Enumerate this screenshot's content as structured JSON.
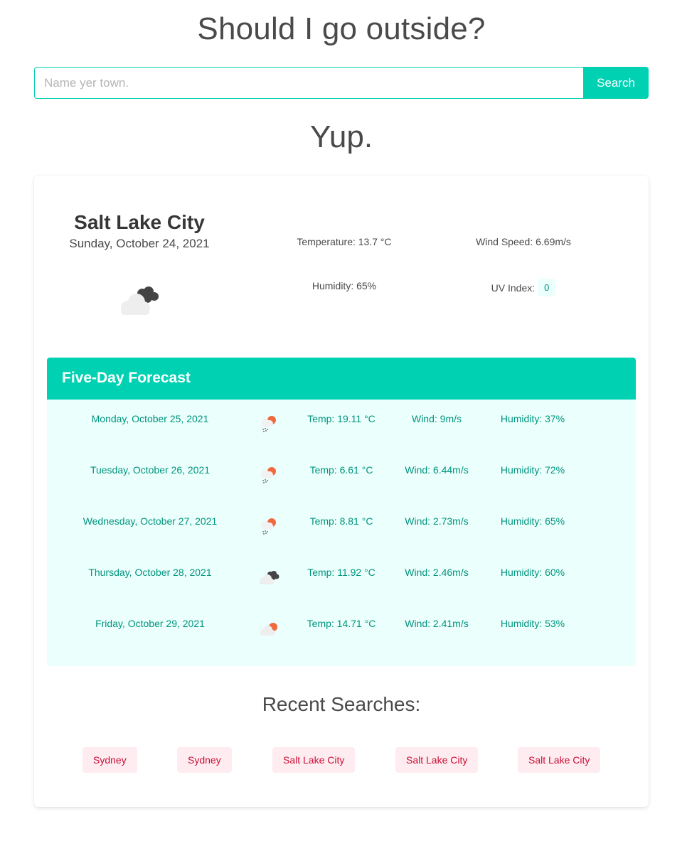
{
  "header": {
    "title": "Should I go outside?"
  },
  "search": {
    "placeholder": "Name yer town.",
    "value": "",
    "button_label": "Search"
  },
  "verdict": "Yup.",
  "current": {
    "city": "Salt Lake City",
    "date": "Sunday, October 24, 2021",
    "icon": "cloudy-icon",
    "temperature": "Temperature: 13.7 °C",
    "wind": "Wind Speed: 6.69m/s",
    "humidity": "Humidity: 65%",
    "uv_label": "UV Index:",
    "uv_value": "0"
  },
  "forecast": {
    "title": "Five-Day Forecast",
    "days": [
      {
        "date": "Monday, October 25, 2021",
        "icon": "sun-rain-icon",
        "temp": "Temp: 19.11 °C",
        "wind": "Wind: 9m/s",
        "humidity": "Humidity: 37%"
      },
      {
        "date": "Tuesday, October 26, 2021",
        "icon": "sun-rain-icon",
        "temp": "Temp: 6.61 °C",
        "wind": "Wind: 6.44m/s",
        "humidity": "Humidity: 72%"
      },
      {
        "date": "Wednesday, October 27, 2021",
        "icon": "sun-rain-icon",
        "temp": "Temp: 8.81 °C",
        "wind": "Wind: 2.73m/s",
        "humidity": "Humidity: 65%"
      },
      {
        "date": "Thursday, October 28, 2021",
        "icon": "cloudy-icon",
        "temp": "Temp: 11.92 °C",
        "wind": "Wind: 2.46m/s",
        "humidity": "Humidity: 60%"
      },
      {
        "date": "Friday, October 29, 2021",
        "icon": "partly-cloudy-icon",
        "temp": "Temp: 14.71 °C",
        "wind": "Wind: 2.41m/s",
        "humidity": "Humidity: 53%"
      }
    ]
  },
  "recent": {
    "title": "Recent Searches:",
    "items": [
      "Sydney",
      "Sydney",
      "Salt Lake City",
      "Salt Lake City",
      "Salt Lake City"
    ]
  },
  "colors": {
    "accent": "#00d1b2",
    "forecast_bg": "#ebfffc",
    "forecast_text": "#00947e",
    "tag_bg": "#feecf0",
    "tag_text": "#cc0f35"
  }
}
